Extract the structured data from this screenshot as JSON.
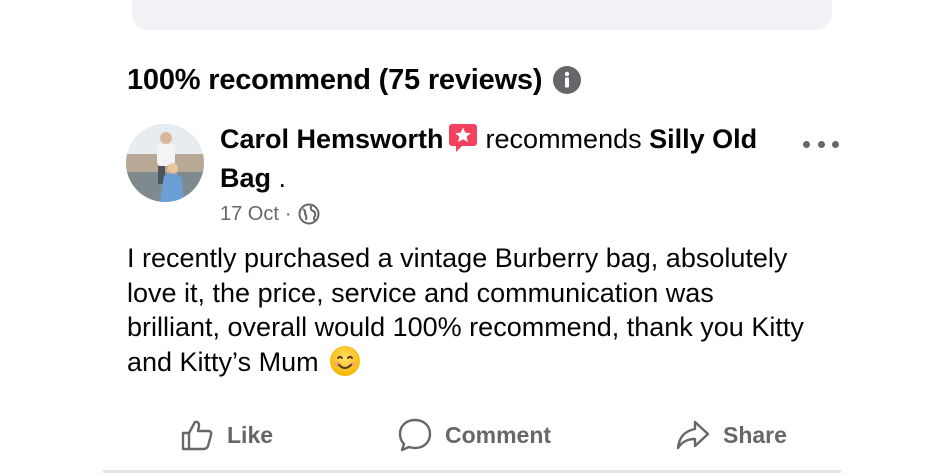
{
  "summary": {
    "heading": "100% recommend (75 reviews)"
  },
  "review": {
    "author": "Carol Hemsworth",
    "verb": "recommends",
    "page_name": "Silly Old Bag",
    "trailing": ".",
    "date": "17 Oct",
    "separator": "·",
    "body": "I recently purchased a vintage Burberry bag, absolutely love it, the price, service and communication was brilliant, overall would 100% recommend, thank you Kitty and Kitty’s Mum"
  },
  "actions": {
    "like": "Like",
    "comment": "Comment",
    "share": "Share"
  },
  "icons": {
    "info": "info-icon",
    "recommend_badge": "star-badge-icon",
    "privacy": "globe-icon",
    "more": "more-options-icon",
    "emoji": "smiling-face-emoji",
    "like": "thumbs-up-icon",
    "comment": "speech-bubble-icon",
    "share": "share-arrow-icon"
  },
  "colors": {
    "badge": "#f3425f",
    "secondary_text": "#65676b",
    "primary_text": "#050505"
  }
}
